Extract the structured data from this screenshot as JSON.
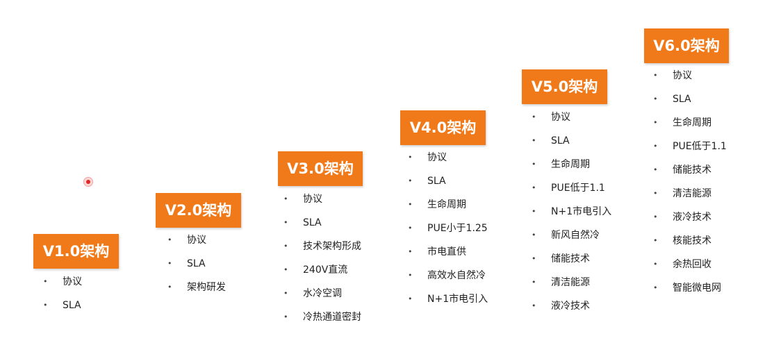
{
  "stages": [
    {
      "title": "V1.0架构",
      "items": [
        "协议",
        "SLA"
      ]
    },
    {
      "title": "V2.0架构",
      "items": [
        "协议",
        "SLA",
        "架构研发"
      ]
    },
    {
      "title": "V3.0架构",
      "items": [
        "协议",
        "SLA",
        "技术架构形成",
        "240V直流",
        "水冷空调",
        "冷热通道密封"
      ]
    },
    {
      "title": "V4.0架构",
      "items": [
        "协议",
        "SLA",
        "生命周期",
        "PUE小于1.25",
        "市电直供",
        "高效水自然冷",
        "N+1市电引入"
      ]
    },
    {
      "title": "V5.0架构",
      "items": [
        "协议",
        "SLA",
        "生命周期",
        "PUE低于1.1",
        "N+1市电引入",
        "新风自然冷",
        "储能技术",
        "清洁能源",
        "液冷技术"
      ]
    },
    {
      "title": "V6.0架构",
      "items": [
        "协议",
        "SLA",
        "生命周期",
        "PUE低于1.1",
        "储能技术",
        "清洁能源",
        "液冷技术",
        "核能技术",
        "余热回收",
        "智能微电网"
      ]
    }
  ],
  "colors": {
    "badge": "#f07a1a",
    "badge_text": "#ffffff"
  },
  "cursor_icon": "red-dot-cursor-icon"
}
